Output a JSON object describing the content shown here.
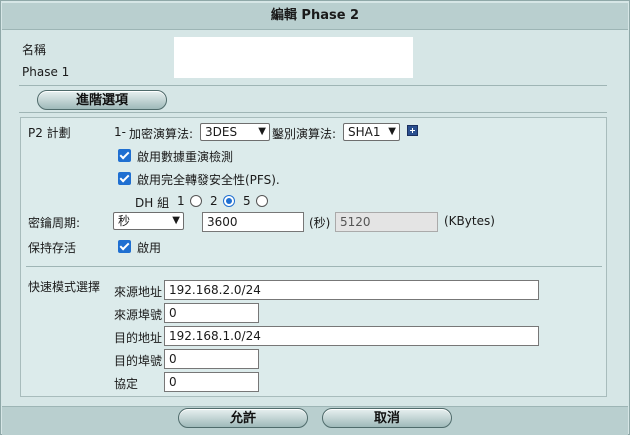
{
  "title": "編輯 Phase 2",
  "name_label": "名稱",
  "phase1_label": "Phase 1",
  "advanced_button": "進階選項",
  "p2_section": {
    "label": "P2 計劃",
    "proposal_prefix": "1-",
    "encryption_label": "加密演算法:",
    "encryption_value": "3DES",
    "auth_label": "鑿別演算法:",
    "auth_value": "SHA1",
    "replay_label": "啟用數據重演檢測",
    "pfs_label": "啟用完全轉發安全性(PFS).",
    "dh_label": "DH 組",
    "dh_options": [
      "1",
      "2",
      "5"
    ],
    "dh_selected": "2"
  },
  "keylife": {
    "label": "密鑰周期:",
    "unit_select": "秒",
    "seconds_value": "3600",
    "seconds_unit": "(秒)",
    "kbytes_value": "5120",
    "kbytes_unit": "(KBytes)"
  },
  "keepalive": {
    "label": "保持存活",
    "checkbox_label": "啟用"
  },
  "quickmode": {
    "label": "快速模式選擇",
    "src_addr_label": "來源地址",
    "src_addr_value": "192.168.2.0/24",
    "src_port_label": "來源埠號",
    "src_port_value": "0",
    "dst_addr_label": "目的地址",
    "dst_addr_value": "192.168.1.0/24",
    "dst_port_label": "目的埠號",
    "dst_port_value": "0",
    "protocol_label": "協定",
    "protocol_value": "0"
  },
  "buttons": {
    "ok": "允許",
    "cancel": "取消"
  },
  "colors": {
    "background": "#d6e6e6",
    "header": "#b9cfcf",
    "checkbox": "#1f6fd1"
  }
}
